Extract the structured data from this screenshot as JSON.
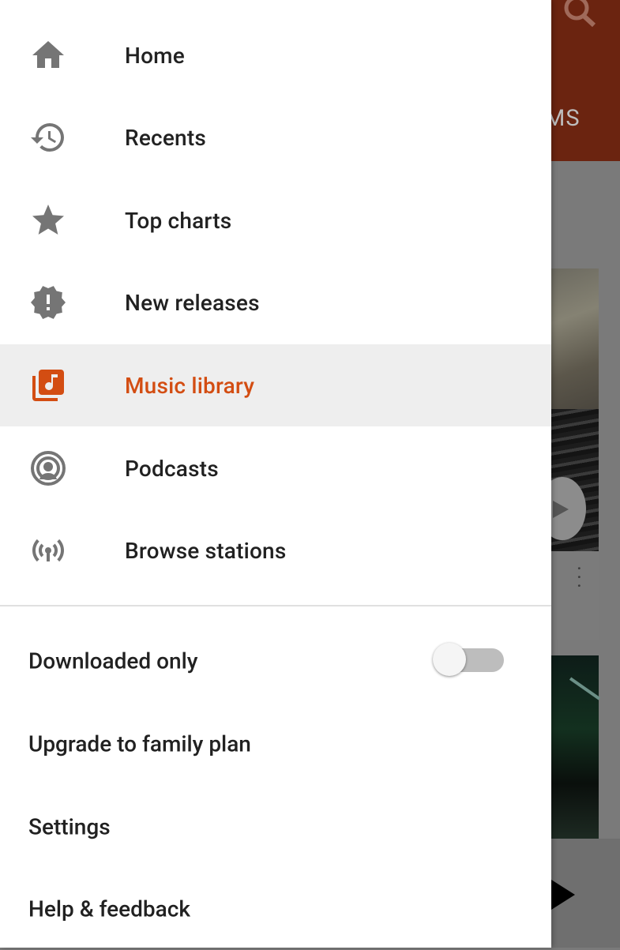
{
  "nav": {
    "items": [
      {
        "label": "Home",
        "icon": "home-icon",
        "active": false
      },
      {
        "label": "Recents",
        "icon": "history-icon",
        "active": false
      },
      {
        "label": "Top charts",
        "icon": "star-icon",
        "active": false
      },
      {
        "label": "New releases",
        "icon": "new-releases-icon",
        "active": false
      },
      {
        "label": "Music library",
        "icon": "library-music-icon",
        "active": true
      },
      {
        "label": "Podcasts",
        "icon": "podcast-icon",
        "active": false
      },
      {
        "label": "Browse stations",
        "icon": "radio-station-icon",
        "active": false
      }
    ]
  },
  "secondary": {
    "downloaded_only": {
      "label": "Downloaded only",
      "enabled": false
    },
    "upgrade": "Upgrade to family plan",
    "settings": "Settings",
    "help": "Help & feedback"
  },
  "background": {
    "tab_text_fragment": "MS"
  },
  "colors": {
    "accent": "#d34d12",
    "icon_gray": "#757575",
    "text": "#212121",
    "active_bg": "#eeeeee"
  }
}
